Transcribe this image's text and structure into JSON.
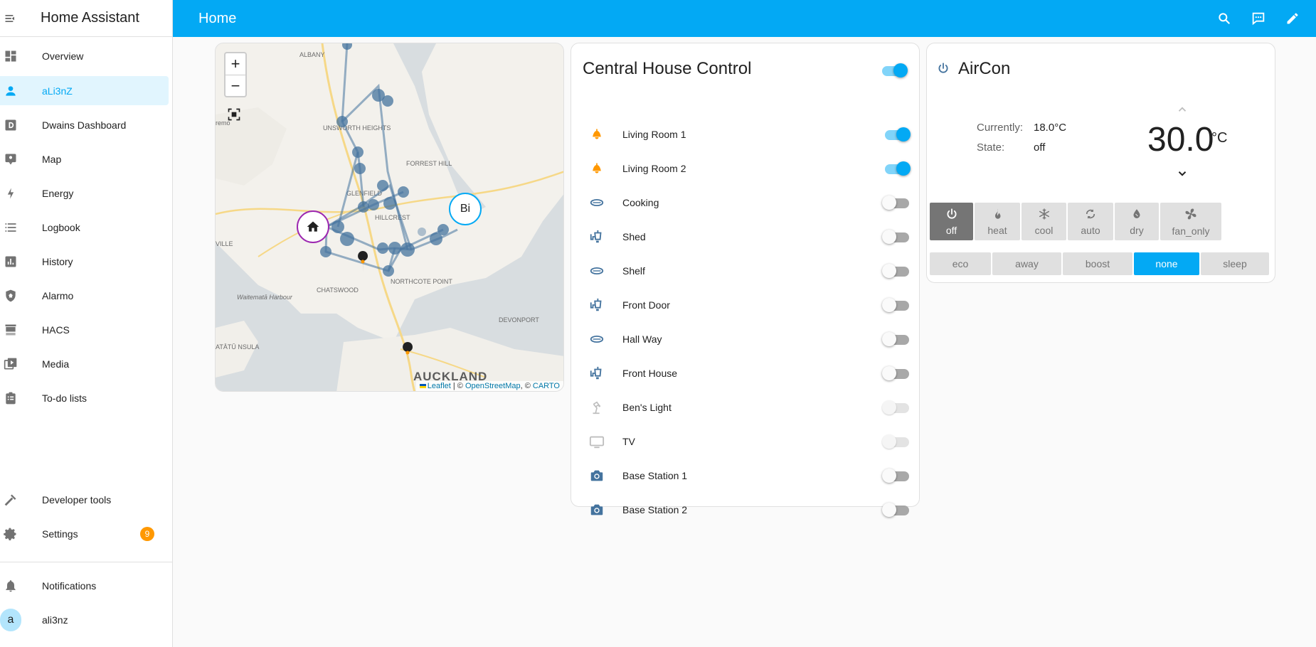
{
  "app": {
    "title": "Home Assistant"
  },
  "sidebar": {
    "items": [
      {
        "label": "Overview"
      },
      {
        "label": "aLi3nZ"
      },
      {
        "label": "Dwains Dashboard"
      },
      {
        "label": "Map"
      },
      {
        "label": "Energy"
      },
      {
        "label": "Logbook"
      },
      {
        "label": "History"
      },
      {
        "label": "Alarmo"
      },
      {
        "label": "HACS"
      },
      {
        "label": "Media"
      },
      {
        "label": "To-do lists"
      }
    ],
    "developer_tools": "Developer tools",
    "settings": "Settings",
    "settings_badge": "9",
    "notifications": "Notifications",
    "user_name": "ali3nz",
    "user_initial": "a"
  },
  "header": {
    "title": "Home"
  },
  "map": {
    "zoom_in": "+",
    "zoom_out": "−",
    "labels": [
      "ALBANY",
      "UNSWORTH HEIGHTS",
      "FORREST HILL",
      "GLENFIELD",
      "HILLCREST",
      "NORTHCOTE POINT",
      "CHATSWOOD",
      "DEVONPORT",
      "Waitematā Harbour",
      "AUCKLAND",
      "VILLE",
      "remo",
      "ATĀTŪ NSULA"
    ],
    "person_marker": "Bi",
    "attribution": {
      "leaflet": "Leaflet",
      "osm": "OpenStreetMap",
      "carto": "CARTO",
      "sep1": " | © ",
      "sep2": ", © "
    }
  },
  "central": {
    "title": "Central House Control",
    "master_on": true,
    "entities": [
      {
        "name": "Living Room 1",
        "icon": "bell-lamp-icon",
        "state": "on"
      },
      {
        "name": "Living Room 2",
        "icon": "bell-lamp-icon",
        "state": "on"
      },
      {
        "name": "Cooking",
        "icon": "ceiling-light-icon",
        "state": "off"
      },
      {
        "name": "Shed",
        "icon": "outdoor-lamp-icon",
        "state": "off"
      },
      {
        "name": "Shelf",
        "icon": "ceiling-light-icon",
        "state": "off"
      },
      {
        "name": "Front Door",
        "icon": "outdoor-lamp-icon",
        "state": "off"
      },
      {
        "name": "Hall Way",
        "icon": "ceiling-light-icon",
        "state": "off"
      },
      {
        "name": "Front House",
        "icon": "outdoor-lamp-icon",
        "state": "off"
      },
      {
        "name": "Ben's Light",
        "icon": "desk-lamp-icon",
        "state": "unavailable"
      },
      {
        "name": "TV",
        "icon": "tv-icon",
        "state": "unavailable"
      },
      {
        "name": "Base Station 1",
        "icon": "camera-icon",
        "state": "off"
      },
      {
        "name": "Base Station 2",
        "icon": "camera-icon",
        "state": "off"
      }
    ]
  },
  "aircon": {
    "title": "AirCon",
    "currently_label": "Currently:",
    "currently_value": "18.0°C",
    "state_label": "State:",
    "state_value": "off",
    "target_temp": "30.0",
    "unit": "°C",
    "modes": [
      {
        "label": "off",
        "icon": "power-icon",
        "active": true
      },
      {
        "label": "heat",
        "icon": "fire-icon",
        "active": false
      },
      {
        "label": "cool",
        "icon": "snowflake-icon",
        "active": false
      },
      {
        "label": "auto",
        "icon": "cycle-icon",
        "active": false
      },
      {
        "label": "dry",
        "icon": "water-drop-icon",
        "active": false
      },
      {
        "label": "fan_only",
        "icon": "fan-icon",
        "active": false
      }
    ],
    "presets": [
      {
        "label": "eco",
        "active": false
      },
      {
        "label": "away",
        "active": false
      },
      {
        "label": "boost",
        "active": false
      },
      {
        "label": "none",
        "active": true
      },
      {
        "label": "sleep",
        "active": false
      }
    ]
  },
  "colors": {
    "accent": "#03a9f4",
    "light_on": "#ff9800",
    "entity_icon": "#44739e",
    "badge": "#ff9800"
  }
}
